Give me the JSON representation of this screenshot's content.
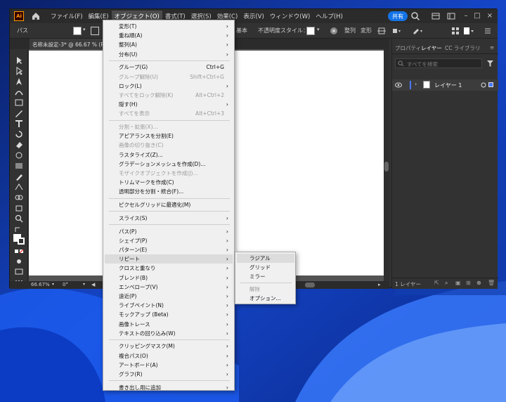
{
  "colors": {
    "accent": "#1473e6",
    "ai_orange": "#ff9a00"
  },
  "app": {
    "logo": "Ai"
  },
  "menubar": {
    "items": [
      "ファイル(F)",
      "編集(E)",
      "オブジェクト(O)",
      "書式(T)",
      "選択(S)",
      "効果(C)",
      "表示(V)",
      "ウィンドウ(W)",
      "ヘルプ(H)"
    ],
    "share": "共有"
  },
  "controlbar": {
    "path_label": "パス",
    "basic": "基本",
    "opacity": "不透明度",
    "style": "スタイル：",
    "align": "整列",
    "transform": "変形"
  },
  "document": {
    "tab": "名称未設定-3* @ 66.67 % (RGB/..."
  },
  "status": {
    "zoom": "66.67%",
    "rotation": "0°"
  },
  "panel": {
    "tabs": [
      "プロパティ",
      "レイヤー",
      "CC ライブラリ"
    ],
    "search_placeholder": "すべてを検索",
    "layer_name": "レイヤー 1",
    "footer": "1 レイヤー"
  },
  "object_menu": {
    "items": [
      {
        "label": "変形(T)",
        "submenu": true
      },
      {
        "label": "重ね順(A)",
        "submenu": true
      },
      {
        "label": "整列(A)",
        "submenu": true
      },
      {
        "label": "分布(U)",
        "submenu": true
      },
      {
        "label": "グループ(G)",
        "shortcut": "Ctrl+G"
      },
      {
        "label": "グループ解除(U)",
        "shortcut": "Shift+Ctrl+G",
        "disabled": true
      },
      {
        "label": "ロック(L)",
        "submenu": true
      },
      {
        "label": "すべてをロック解除(K)",
        "shortcut": "Alt+Ctrl+2",
        "disabled": true
      },
      {
        "label": "隠す(H)",
        "submenu": true
      },
      {
        "label": "すべてを表示",
        "shortcut": "Alt+Ctrl+3",
        "disabled": true
      },
      {
        "label": "分割・拡張(X)...",
        "disabled": true
      },
      {
        "label": "アピアランスを分割(E)"
      },
      {
        "label": "画像の切り抜き(C)",
        "disabled": true
      },
      {
        "label": "ラスタライズ(Z)..."
      },
      {
        "label": "グラデーションメッシュを作成(D)..."
      },
      {
        "label": "モザイクオブジェクトを作成(J)...",
        "disabled": true
      },
      {
        "label": "トリムマークを作成(C)"
      },
      {
        "label": "透明部分を分割・統合(F)..."
      },
      {
        "label": "ピクセルグリッドに最適化(M)"
      },
      {
        "label": "スライス(S)",
        "submenu": true
      },
      {
        "label": "パス(P)",
        "submenu": true
      },
      {
        "label": "シェイプ(P)",
        "submenu": true
      },
      {
        "label": "パターン(E)",
        "submenu": true
      },
      {
        "label": "リピート",
        "submenu": true,
        "highlight": true
      },
      {
        "label": "クロスと重なり",
        "submenu": true
      },
      {
        "label": "ブレンド(B)",
        "submenu": true
      },
      {
        "label": "エンベロープ(V)",
        "submenu": true
      },
      {
        "label": "遠近(P)",
        "submenu": true
      },
      {
        "label": "ライブペイント(N)",
        "submenu": true
      },
      {
        "label": "モックアップ (Beta)",
        "submenu": true
      },
      {
        "label": "画像トレース",
        "submenu": true
      },
      {
        "label": "テキストの回り込み(W)",
        "submenu": true
      },
      {
        "label": "クリッピングマスク(M)",
        "submenu": true
      },
      {
        "label": "複合パス(O)",
        "submenu": true
      },
      {
        "label": "アートボード(A)",
        "submenu": true
      },
      {
        "label": "グラフ(R)",
        "submenu": true
      },
      {
        "label": "書き出し用に追加",
        "submenu": true
      }
    ]
  },
  "repeat_submenu": {
    "items": [
      {
        "label": "ラジアル",
        "highlight": true
      },
      {
        "label": "グリッド"
      },
      {
        "label": "ミラー"
      },
      {
        "label": "解除",
        "disabled": true
      },
      {
        "label": "オプション..."
      }
    ]
  }
}
